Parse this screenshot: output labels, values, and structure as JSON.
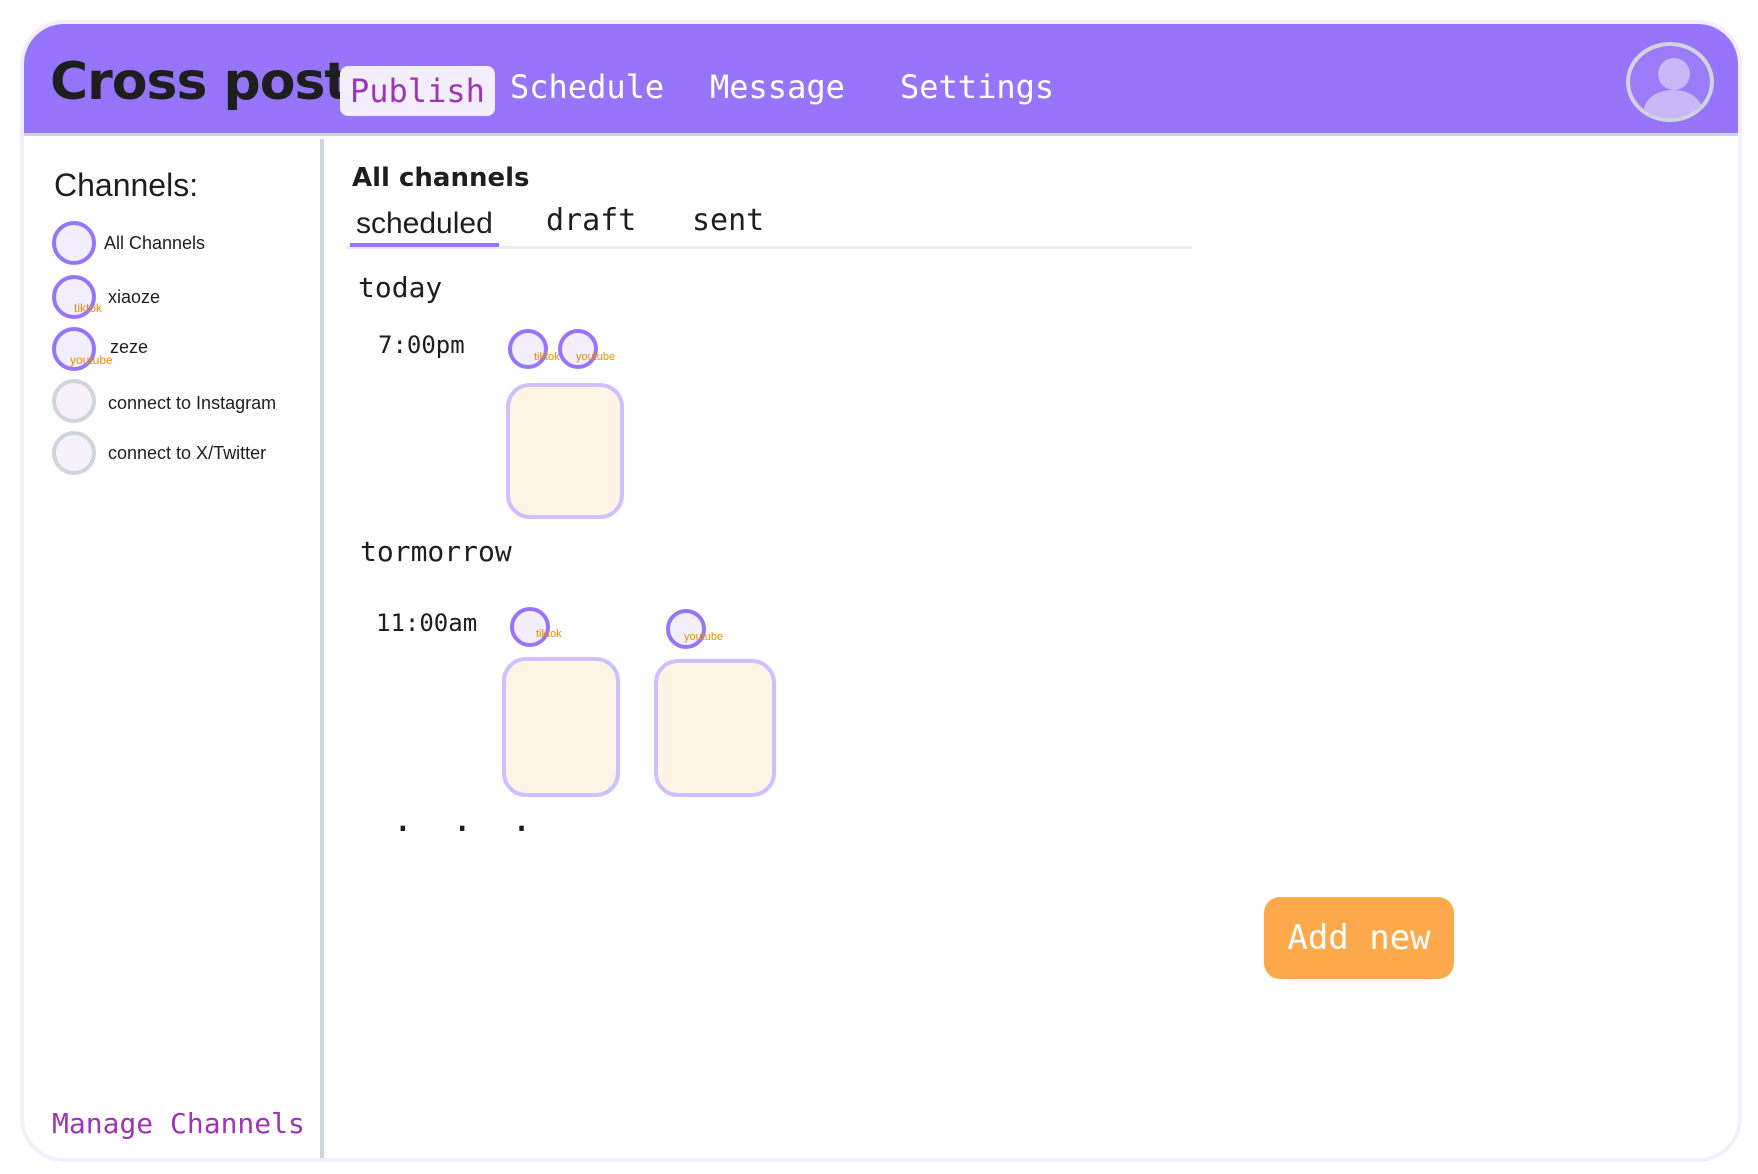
{
  "header": {
    "brand": "Cross post",
    "tabs": [
      {
        "label": "Publish",
        "active": true
      },
      {
        "label": "Schedule",
        "active": false
      },
      {
        "label": "Message",
        "active": false
      },
      {
        "label": "Settings",
        "active": false
      }
    ],
    "avatar_icon": "user-avatar-icon"
  },
  "sidebar": {
    "title": "Channels:",
    "channels": [
      {
        "label": "All Channels",
        "tag": "",
        "connected": true
      },
      {
        "label": "xiaoze",
        "tag": "tiktok",
        "connected": true
      },
      {
        "label": "zeze",
        "tag": "youtube",
        "connected": true
      },
      {
        "label": "connect to Instagram",
        "tag": "",
        "connected": false
      },
      {
        "label": "connect to X/Twitter",
        "tag": "",
        "connected": false
      }
    ],
    "manage_label": "Manage Channels"
  },
  "main": {
    "title": "All channels",
    "subtabs": [
      {
        "label": "scheduled",
        "active": true
      },
      {
        "label": "draft",
        "active": false
      },
      {
        "label": "sent",
        "active": false
      }
    ],
    "groups": [
      {
        "day": "today",
        "slots": [
          {
            "time": "7:00pm",
            "channels": [
              "tiktok",
              "youtube"
            ]
          }
        ]
      },
      {
        "day": "tormorrow",
        "slots": [
          {
            "time": "11:00am",
            "channels": [
              "tiktok",
              "youtube"
            ]
          }
        ]
      }
    ],
    "more": ". . .",
    "add_button": "Add new"
  },
  "colors": {
    "accent": "#9775fa",
    "brand_text": "#1e1e1e",
    "active_tab_text": "#9c36b5",
    "tag": "#f08c00",
    "card_fill": "#fff4e6",
    "card_border": "#d0bfff",
    "add_button": "#ffa94d"
  }
}
